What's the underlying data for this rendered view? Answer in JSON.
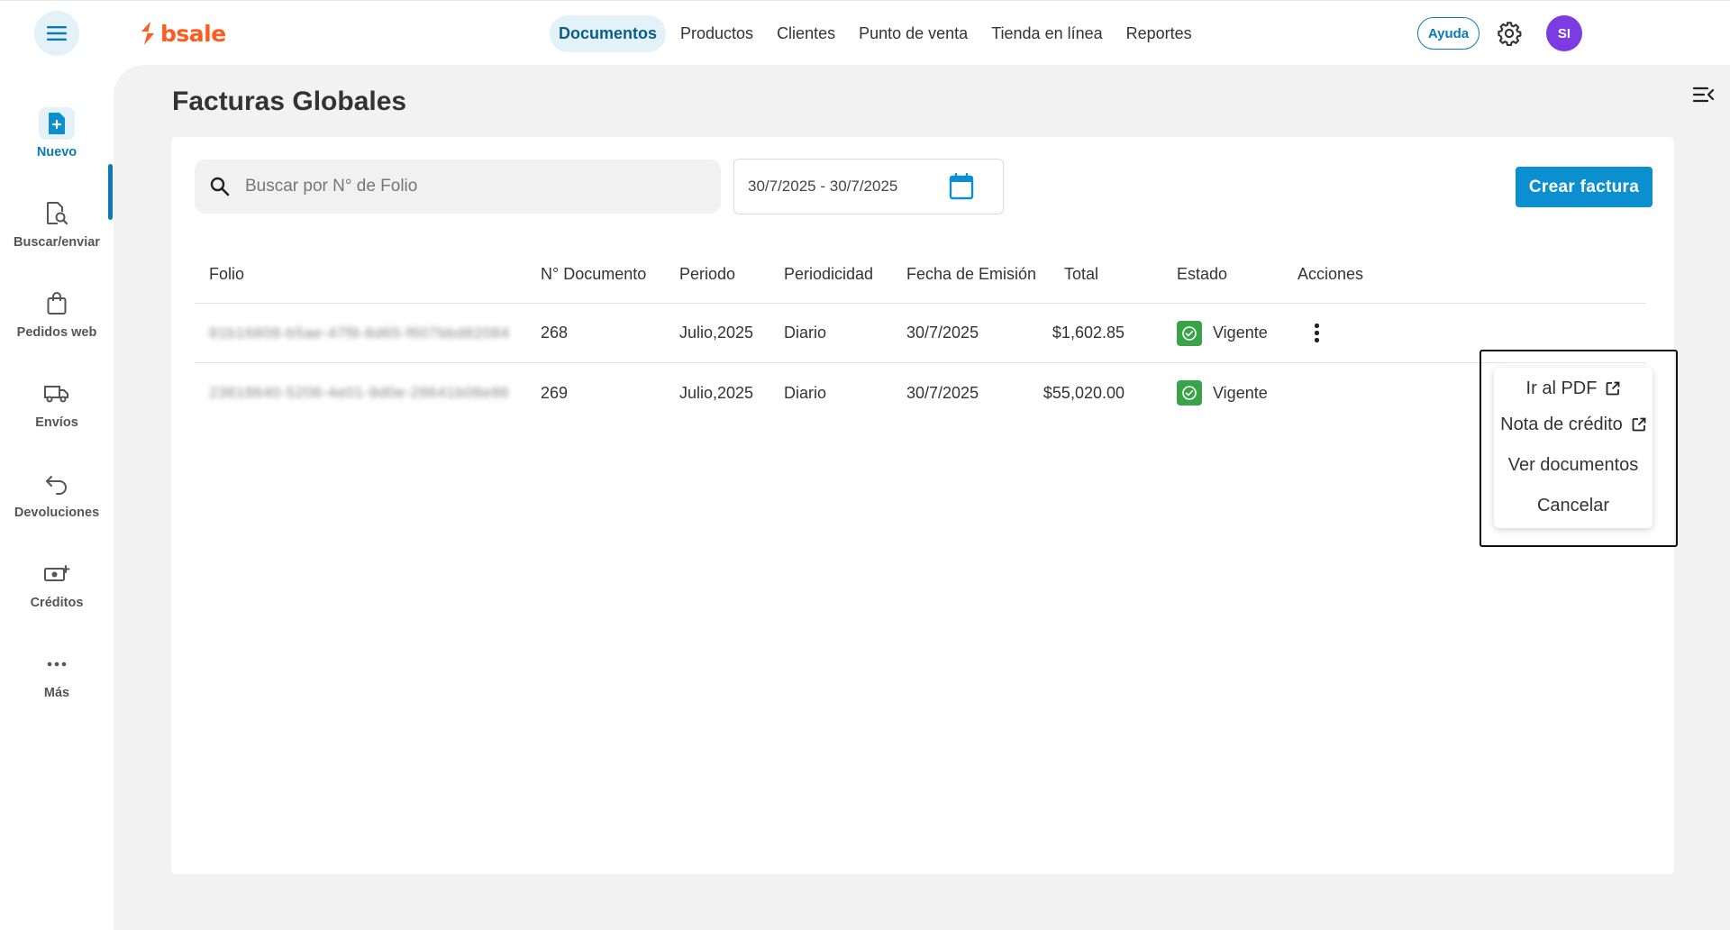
{
  "brand": {
    "name": "bsale",
    "color": "#ff5a1f"
  },
  "header": {
    "menu_icon": "hamburger-icon",
    "nav": [
      {
        "label": "Documentos",
        "active": true
      },
      {
        "label": "Productos",
        "active": false
      },
      {
        "label": "Clientes",
        "active": false
      },
      {
        "label": "Punto de venta",
        "active": false
      },
      {
        "label": "Tienda en línea",
        "active": false
      },
      {
        "label": "Reportes",
        "active": false
      }
    ],
    "help_label": "Ayuda",
    "settings_icon": "gear-icon",
    "avatar_initials": "SI",
    "avatar_color": "#7d3ce3"
  },
  "sidebar": {
    "items": [
      {
        "label": "Nuevo",
        "icon": "new-document-icon",
        "active": true
      },
      {
        "label": "Buscar/enviar",
        "icon": "search-document-icon",
        "active": false
      },
      {
        "label": "Pedidos web",
        "icon": "shopping-bag-icon",
        "active": false
      },
      {
        "label": "Envíos",
        "icon": "truck-icon",
        "active": false
      },
      {
        "label": "Devoluciones",
        "icon": "return-arrow-icon",
        "active": false
      },
      {
        "label": "Créditos",
        "icon": "money-add-icon",
        "active": false
      },
      {
        "label": "Más",
        "icon": "more-horizontal-icon",
        "active": false
      }
    ]
  },
  "page": {
    "title": "Facturas Globales",
    "search_placeholder": "Buscar por N° de Folio",
    "date_range": "30/7/2025 - 30/7/2025",
    "create_button": "Crear factura",
    "accent_color": "#0b8fcf"
  },
  "table": {
    "headers": {
      "folio": "Folio",
      "documento": "N° Documento",
      "periodo": "Periodo",
      "periodicidad": "Periodicidad",
      "fecha": "Fecha de Emisión",
      "total": "Total",
      "estado": "Estado",
      "acciones": "Acciones"
    },
    "rows": [
      {
        "folio": "81b16808-b5ae-47f8-8d65-f607bbd82084",
        "documento": "268",
        "periodo": "Julio,2025",
        "periodicidad": "Diario",
        "fecha": "30/7/2025",
        "total": "$1,602.85",
        "estado": "Vigente"
      },
      {
        "folio": "23818640-5206-4e01-9d0e-28641b08e86",
        "documento": "269",
        "periodo": "Julio,2025",
        "periodicidad": "Diario",
        "fecha": "30/7/2025",
        "total": "$55,020.00",
        "estado": "Vigente"
      }
    ]
  },
  "actions_menu": {
    "items": [
      {
        "label": "Ir al PDF",
        "icon": "external-link-icon"
      },
      {
        "label": "Nota de crédito",
        "icon": "external-link-icon"
      },
      {
        "label": "Ver documentos",
        "icon": ""
      },
      {
        "label": "Cancelar",
        "icon": ""
      }
    ]
  }
}
